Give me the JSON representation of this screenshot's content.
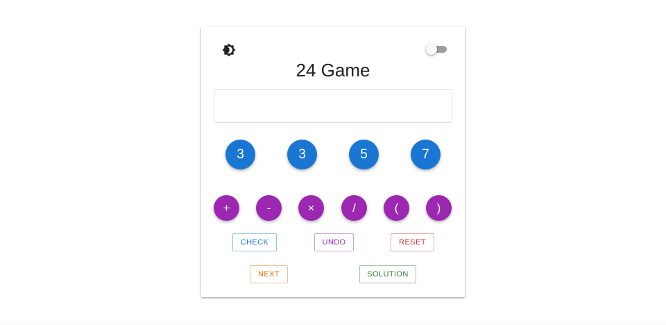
{
  "header": {
    "title": "24 Game",
    "theme_icon": "brightness-icon",
    "dark_mode_toggle": false
  },
  "expression": {
    "value": ""
  },
  "numbers": [
    "3",
    "3",
    "5",
    "7"
  ],
  "operators": [
    "+",
    "-",
    "×",
    "/",
    "(",
    ")"
  ],
  "actions": {
    "check": "CHECK",
    "undo": "UNDO",
    "reset": "RESET",
    "next": "NEXT",
    "solution": "SOLUTION"
  },
  "colors": {
    "number_button": "#1976d2",
    "operator_button": "#9c27b0",
    "check": "#1976d2",
    "undo": "#9c27b0",
    "reset": "#d32f2f",
    "next": "#ed6c02",
    "solution": "#2e7d32"
  }
}
